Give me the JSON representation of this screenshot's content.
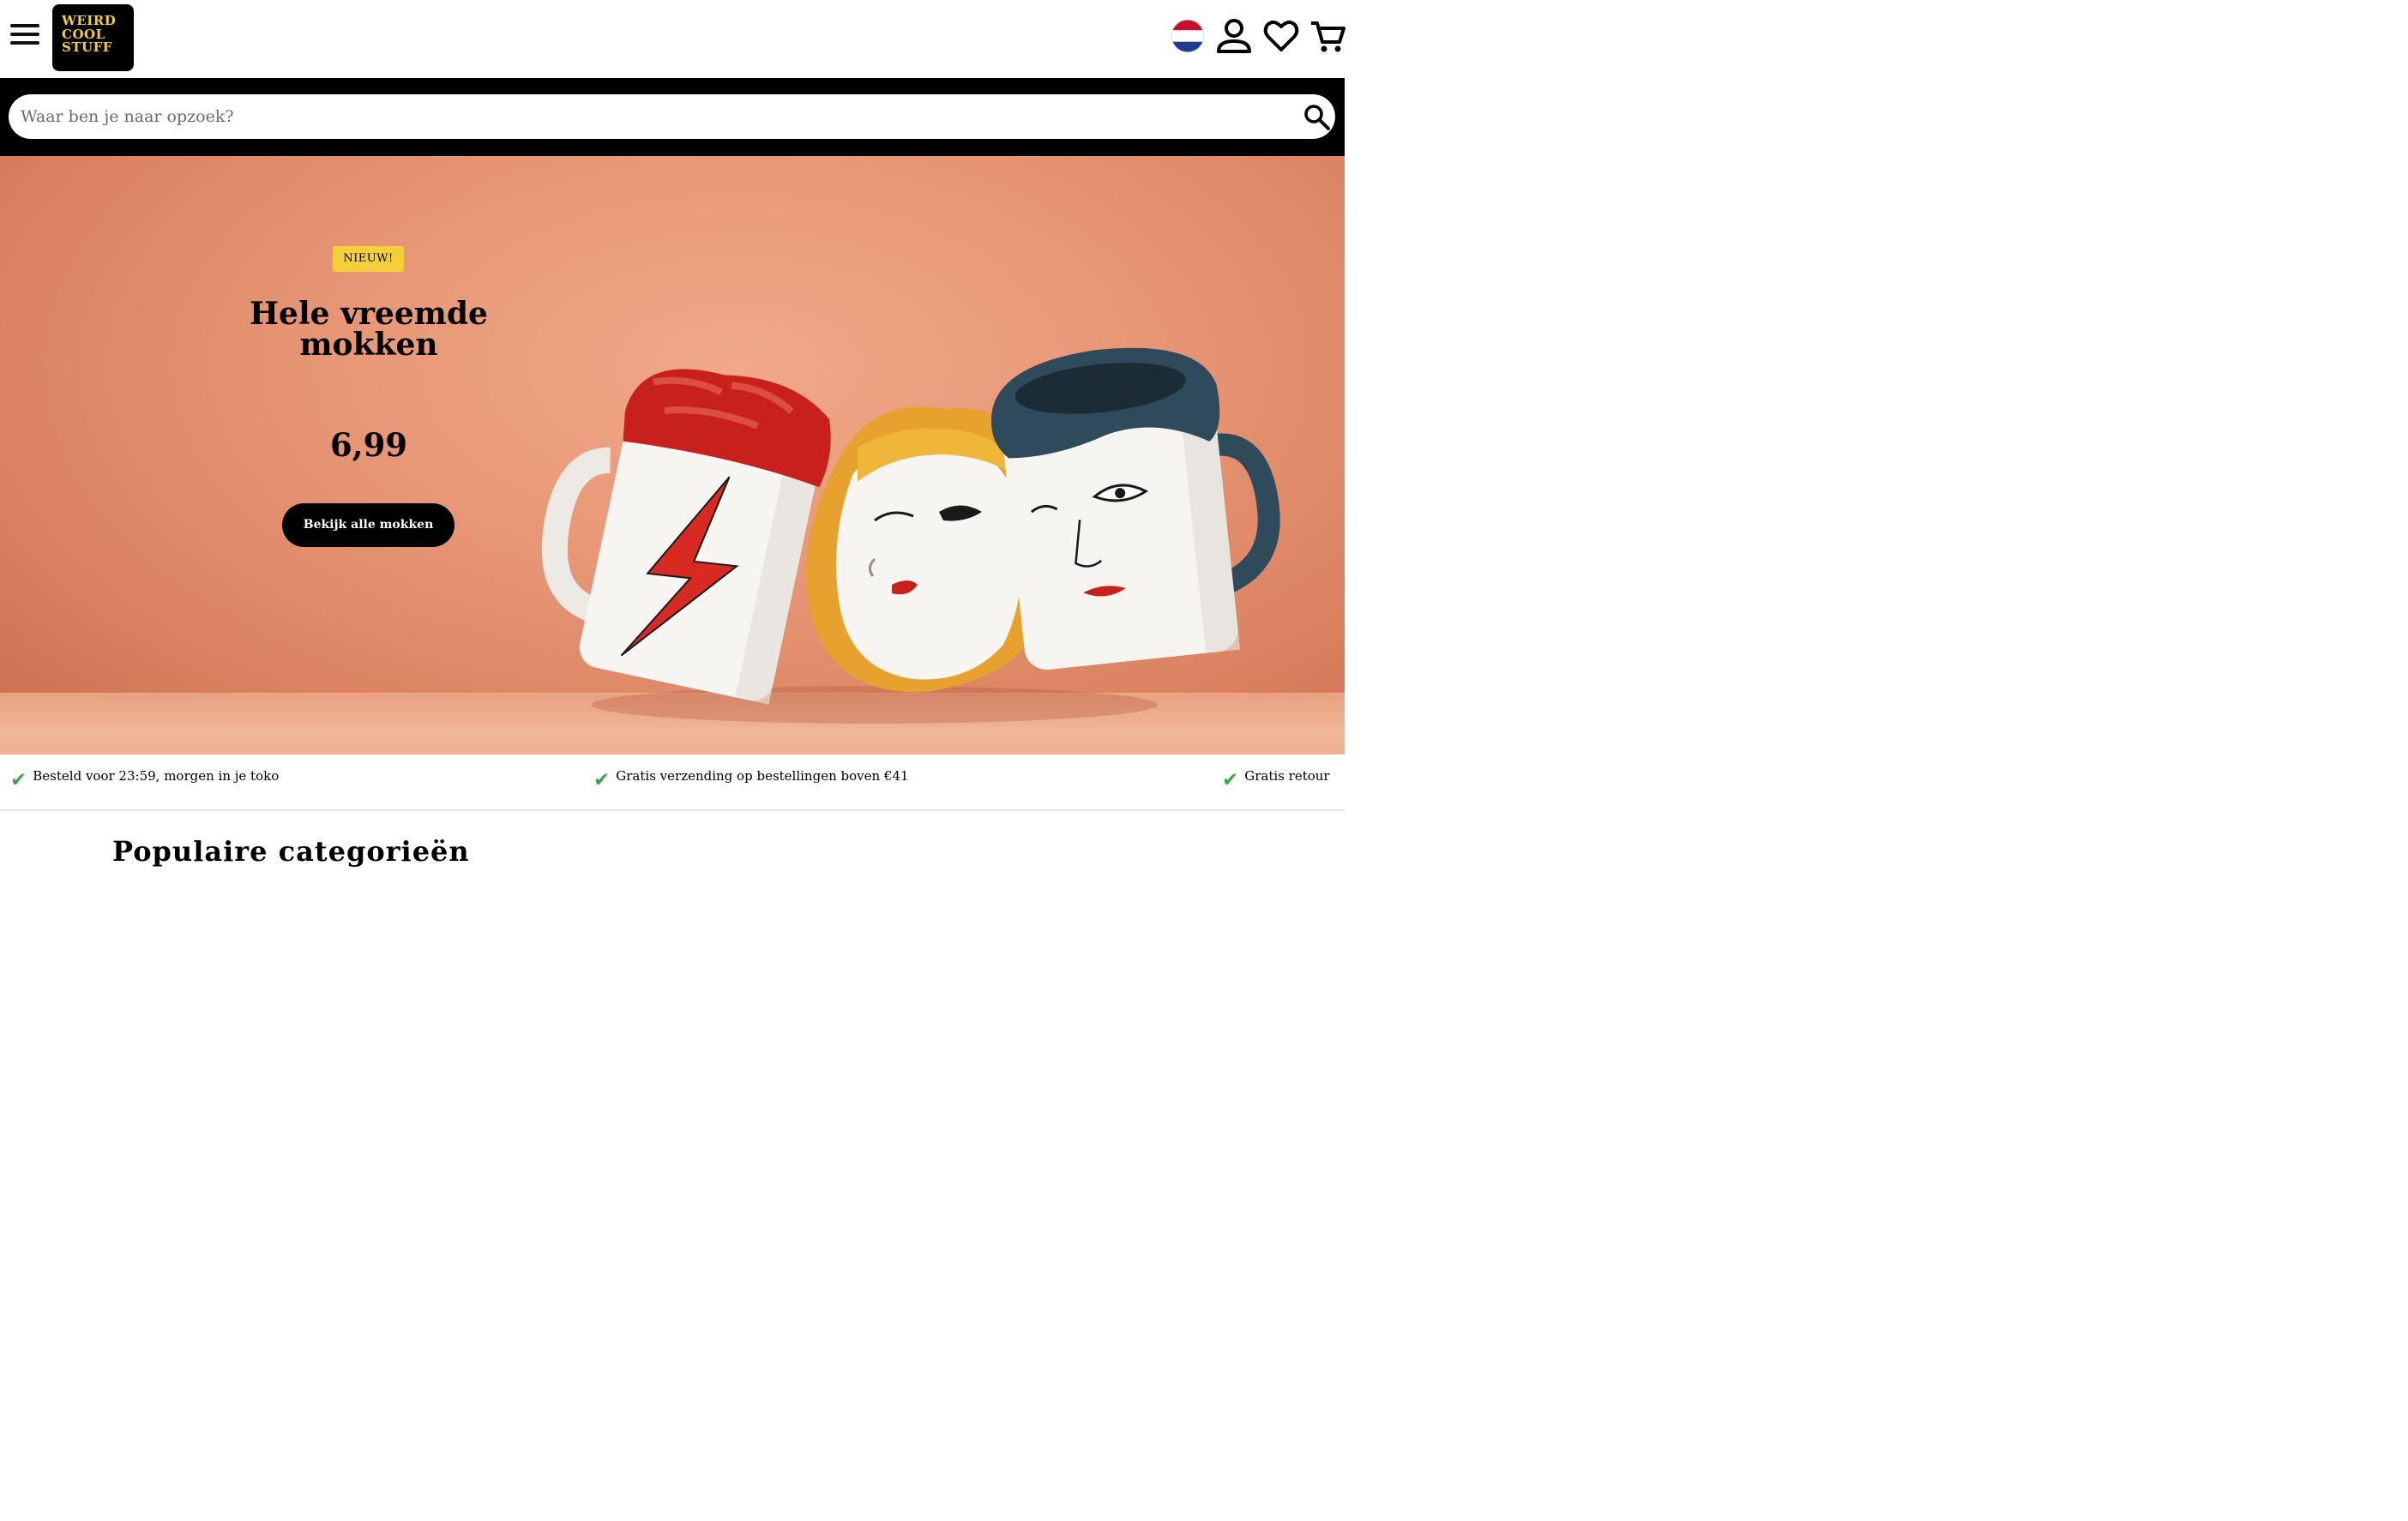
{
  "header": {
    "logo_lines": [
      "WEIRD",
      "COOL",
      "STUFF"
    ],
    "icons": [
      "menu-icon",
      "netherlands-flag-icon",
      "account-icon",
      "heart-icon",
      "cart-icon"
    ]
  },
  "search": {
    "placeholder": "Waar ben je naar opzoek?"
  },
  "hero": {
    "badge": "NIEUW!",
    "title": "Hele vreemde mokken",
    "price": "6,99",
    "cta_label": "Bekijk alle mokken",
    "colors": {
      "badge": "#f4cf3a",
      "background": "#e79675"
    }
  },
  "usps": [
    {
      "text": "Besteld voor 23:59, morgen in je toko"
    },
    {
      "text": "Gratis verzending op bestellingen boven €41"
    },
    {
      "text": "Gratis retour"
    }
  ],
  "colors": {
    "check": "#3aa350",
    "accent": "#f4cf3a"
  },
  "section": {
    "title": "Populaire categorieën"
  }
}
